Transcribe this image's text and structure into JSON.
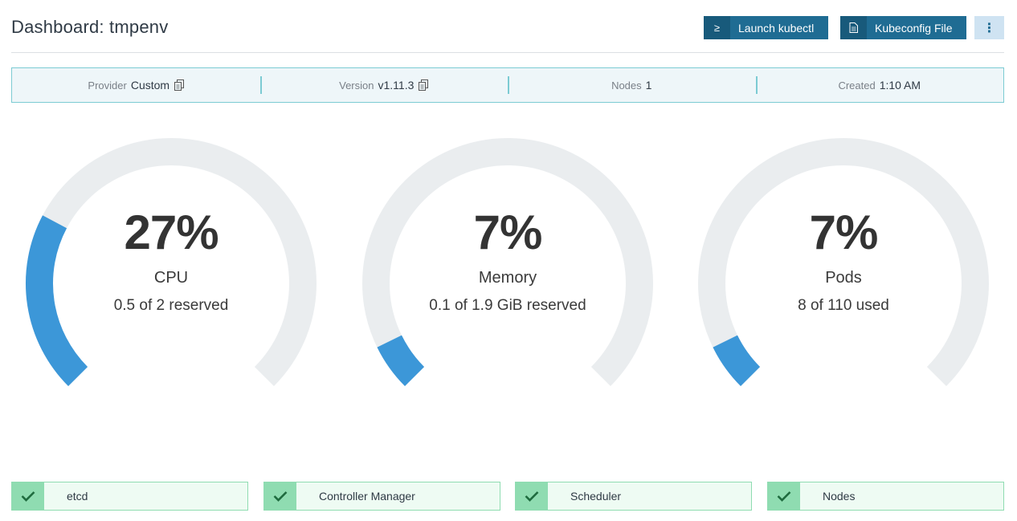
{
  "header": {
    "title": "Dashboard: tmpenv",
    "launch_kubectl": "Launch kubectl",
    "kubeconfig_file": "Kubeconfig File",
    "terminal_glyph": "≥",
    "more_glyph": "⋮"
  },
  "info": {
    "provider_label": "Provider",
    "provider_value": "Custom",
    "version_label": "Version",
    "version_value": "v1.11.3",
    "nodes_label": "Nodes",
    "nodes_value": "1",
    "created_label": "Created",
    "created_value": "1:10 AM"
  },
  "gauges": [
    {
      "percent_text": "27%",
      "percent": 27,
      "title": "CPU",
      "subtitle": "0.5 of 2 reserved"
    },
    {
      "percent_text": "7%",
      "percent": 7,
      "title": "Memory",
      "subtitle": "0.1 of 1.9 GiB reserved"
    },
    {
      "percent_text": "7%",
      "percent": 7,
      "title": "Pods",
      "subtitle": "8 of 110 used"
    }
  ],
  "status": [
    {
      "label": "etcd",
      "state": "healthy"
    },
    {
      "label": "Controller Manager",
      "state": "healthy"
    },
    {
      "label": "Scheduler",
      "state": "healthy"
    },
    {
      "label": "Nodes",
      "state": "healthy"
    }
  ],
  "colors": {
    "primary_button": "#1f6c93",
    "gauge_fill": "#3c97d8",
    "gauge_track": "#eaedef",
    "healthy": "#8fdcb1",
    "info_border": "#7ccbd3"
  }
}
